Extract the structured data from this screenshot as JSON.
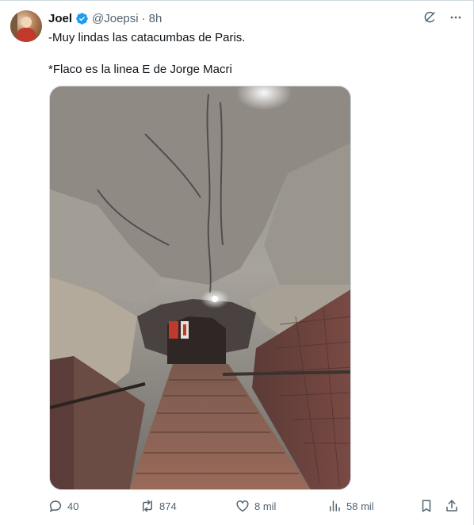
{
  "post": {
    "author": {
      "name": "Joel",
      "handle": "@Joepsi",
      "separator": "·",
      "time": "8h"
    },
    "text_line1": "-Muy lindas las catacumbas de Paris.",
    "text_line2": "*Flaco es la linea E de Jorge Macri",
    "icons": {
      "verified": "verified-badge-icon",
      "grok": "grok-icon",
      "more": "more-dots-icon"
    },
    "metrics": {
      "replies": "40",
      "reposts": "874",
      "likes": "8 mil",
      "views": "58 mil"
    }
  },
  "colors": {
    "accent": "#1d9bf0",
    "text": "#0f1419",
    "secondary": "#536471",
    "border": "#cfd9de"
  }
}
